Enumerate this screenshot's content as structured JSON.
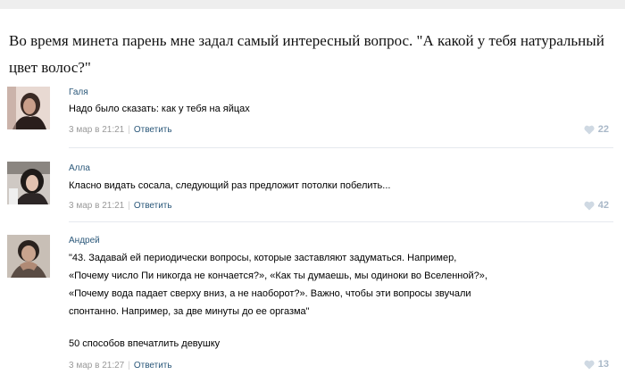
{
  "post": {
    "text": "Во время минета парень мне задал самый интересный вопрос. \"А какой у тебя натуральный цвет волос?\""
  },
  "comments": [
    {
      "author": "Галя",
      "lines": [
        "Надо было сказать: как у тебя на яйцах"
      ],
      "date": "3 мар в 21:21",
      "reply": "Ответить",
      "likes": "22",
      "avatar_icon": "avatar-photo-icon"
    },
    {
      "author": "Алла",
      "lines": [
        "Класно видать сосала, следующий раз предложит потолки побелить..."
      ],
      "date": "3 мар в 21:21",
      "reply": "Ответить",
      "likes": "42",
      "avatar_icon": "avatar-photo-icon"
    },
    {
      "author": "Андрей",
      "lines": [
        "\"43. Задавай ей периодически вопросы, которые заставляют задуматься. Например,",
        "«Почему число Пи никогда не кончается?», «Как ты думаешь, мы одиноки во Вселенной?»,",
        "«Почему вода падает сверху вниз, а не наоборот?». Важно, чтобы эти вопросы звучали",
        "спонтанно. Например, за две минуты до ее оргазма\""
      ],
      "extra": "50 способов впечатлить девушку",
      "date": "3 мар в 21:27",
      "reply": "Ответить",
      "likes": "13",
      "avatar_icon": "avatar-photo-icon"
    }
  ],
  "colors": {
    "link": "#2b587a",
    "meta": "#999999",
    "likes": "#a9b8c8",
    "divider": "#e5e9ee"
  },
  "icons": {
    "like": "heart-icon"
  }
}
